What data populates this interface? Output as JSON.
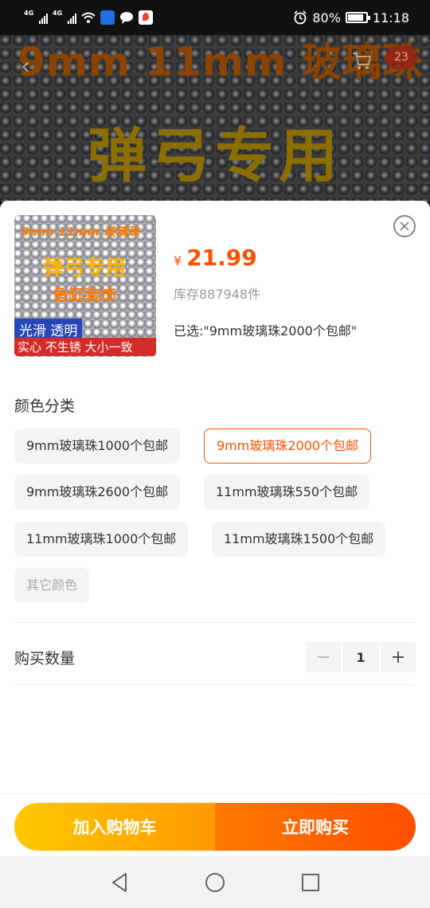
{
  "status_bar": {
    "network_1": "4G",
    "network_2": "4G",
    "battery": "80%",
    "time": "11:18"
  },
  "background": {
    "title": "9mm 11mm 玻璃珠",
    "subtitle": "弹弓专用",
    "cart_badge": "23"
  },
  "product": {
    "thumbnail": {
      "line1": "9mm 11mm 玻璃珠",
      "line2": "弹弓专用",
      "line3": "鱼缸装饰",
      "line4": "光滑 透明",
      "line5": "实心 不生锈 大小一致"
    },
    "currency": "¥",
    "price": "21.99",
    "stock": "库存887948件",
    "selected": "已选:\"9mm玻璃珠2000个包邮\""
  },
  "color_section": {
    "title": "颜色分类",
    "options": [
      {
        "label": "9mm玻璃珠1000个包邮",
        "state": "normal"
      },
      {
        "label": "9mm玻璃珠2000个包邮",
        "state": "selected"
      },
      {
        "label": "9mm玻璃珠2600个包邮",
        "state": "normal"
      },
      {
        "label": "11mm玻璃珠550个包邮",
        "state": "normal"
      },
      {
        "label": "11mm玻璃珠1000个包邮",
        "state": "normal"
      },
      {
        "label": "11mm玻璃珠1500个包邮",
        "state": "normal"
      },
      {
        "label": "其它颜色",
        "state": "disabled"
      }
    ]
  },
  "quantity": {
    "label": "购买数量",
    "value": "1"
  },
  "actions": {
    "add_to_cart": "加入购物车",
    "buy_now": "立即购买"
  },
  "colors": {
    "accent": "#ff5000",
    "cart_gradient_start": "#ffc800",
    "buy_gradient_end": "#ff4f00"
  },
  "icons": [
    "back-icon",
    "cart-icon",
    "close-icon",
    "minus-icon",
    "plus-icon",
    "nav-back-icon",
    "nav-home-icon",
    "nav-recents-icon"
  ]
}
